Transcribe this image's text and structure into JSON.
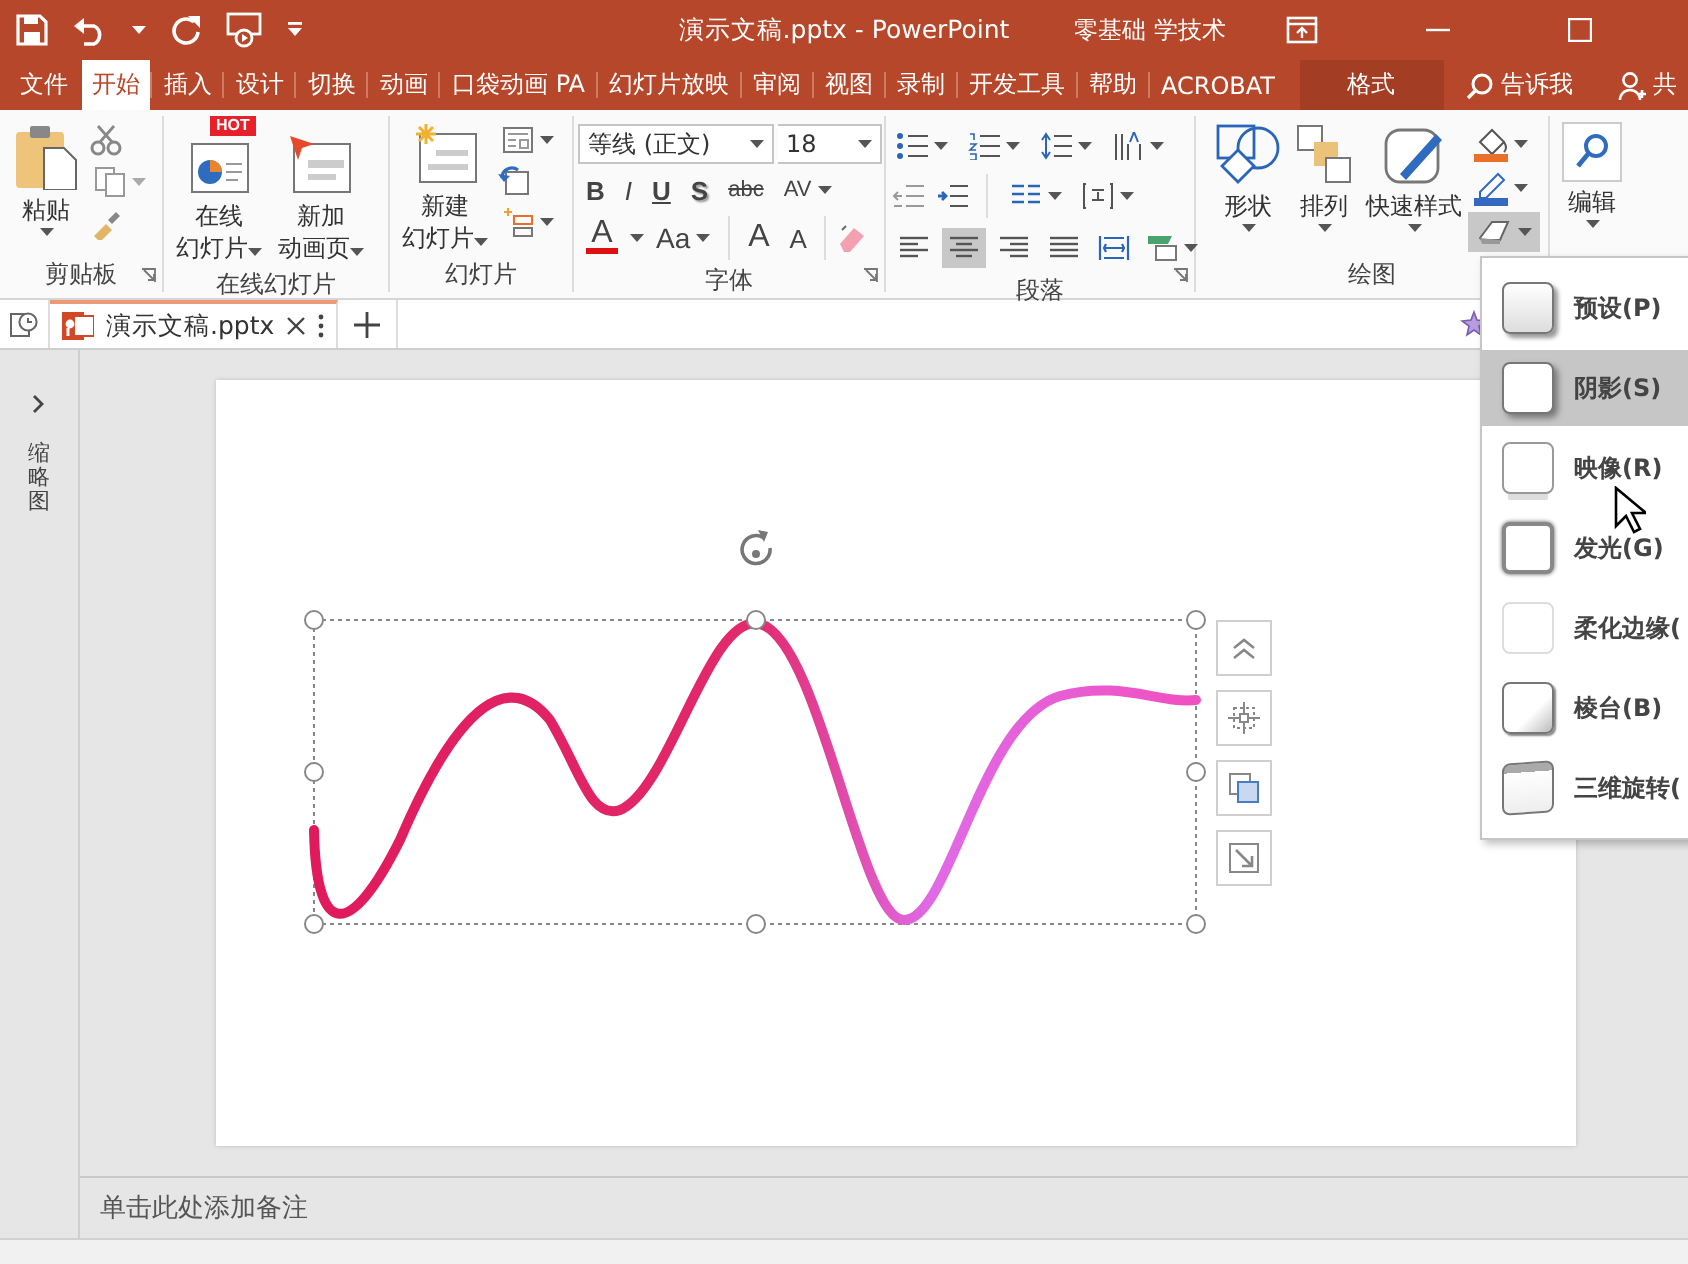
{
  "title_bar": {
    "title": "演示文稿.pptx  -  PowerPoint",
    "user": "零基础 学技术"
  },
  "menu_tabs": [
    {
      "label": "文件",
      "selected": false,
      "kind": "normal"
    },
    {
      "label": "开始",
      "selected": true,
      "kind": "normal"
    },
    {
      "label": "插入",
      "selected": false,
      "kind": "normal"
    },
    {
      "label": "设计",
      "selected": false,
      "kind": "normal"
    },
    {
      "label": "切换",
      "selected": false,
      "kind": "normal"
    },
    {
      "label": "动画",
      "selected": false,
      "kind": "normal"
    },
    {
      "label": "口袋动画 PA",
      "selected": false,
      "kind": "normal"
    },
    {
      "label": "幻灯片放映",
      "selected": false,
      "kind": "normal"
    },
    {
      "label": "审阅",
      "selected": false,
      "kind": "normal"
    },
    {
      "label": "视图",
      "selected": false,
      "kind": "normal"
    },
    {
      "label": "录制",
      "selected": false,
      "kind": "normal"
    },
    {
      "label": "开发工具",
      "selected": false,
      "kind": "normal"
    },
    {
      "label": "帮助",
      "selected": false,
      "kind": "normal"
    },
    {
      "label": "ACROBAT",
      "selected": false,
      "kind": "normal"
    },
    {
      "label": "格式",
      "selected": false,
      "kind": "contextual"
    }
  ],
  "tell_me": "告诉我",
  "share": "共",
  "clipboard": {
    "paste": "粘贴",
    "label": "剪贴板"
  },
  "online_slides": {
    "buttons": [
      {
        "lines": [
          "在线",
          "幻灯片"
        ],
        "badge": "HOT"
      },
      {
        "lines": [
          "新加",
          "动画页"
        ]
      }
    ],
    "label": "在线幻灯片"
  },
  "slides": {
    "new_slide": [
      "新建",
      "幻灯片"
    ],
    "label": "幻灯片"
  },
  "font": {
    "face": "等线 (正文)",
    "size": "18",
    "style_buttons": [
      "B",
      "I",
      "U",
      "S",
      "abc",
      "AV"
    ],
    "size_buttons": [
      "A",
      "Aa",
      "A",
      "A"
    ],
    "label": "字体"
  },
  "paragraph": {
    "align_buttons": [
      {
        "kind": "left",
        "selected": false
      },
      {
        "kind": "center",
        "selected": true
      },
      {
        "kind": "right",
        "selected": false
      },
      {
        "kind": "justify",
        "selected": false
      },
      {
        "kind": "distributed",
        "selected": false
      }
    ],
    "label": "段落"
  },
  "drawing": {
    "buttons": [
      "形状",
      "排列",
      "快速样式"
    ],
    "effects_expanded": true,
    "label": "绘图"
  },
  "editing": {
    "label": "编辑"
  },
  "document_tab": {
    "title": "演示文稿.pptx"
  },
  "thumbnail_pane": {
    "label": "缩略图"
  },
  "notes": {
    "placeholder": "单击此处添加备注"
  },
  "effects_menu": [
    {
      "label": "预设(P)",
      "kind": "preset",
      "selected": false
    },
    {
      "label": "阴影(S)",
      "kind": "shadow",
      "selected": true
    },
    {
      "label": "映像(R)",
      "kind": "reflection",
      "selected": false
    },
    {
      "label": "发光(G)",
      "kind": "glow",
      "selected": false
    },
    {
      "label": "柔化边缘(",
      "kind": "soft",
      "selected": false
    },
    {
      "label": "棱台(B)",
      "kind": "bevel",
      "selected": false
    },
    {
      "label": "三维旋转(",
      "kind": "rotation",
      "selected": false
    }
  ]
}
